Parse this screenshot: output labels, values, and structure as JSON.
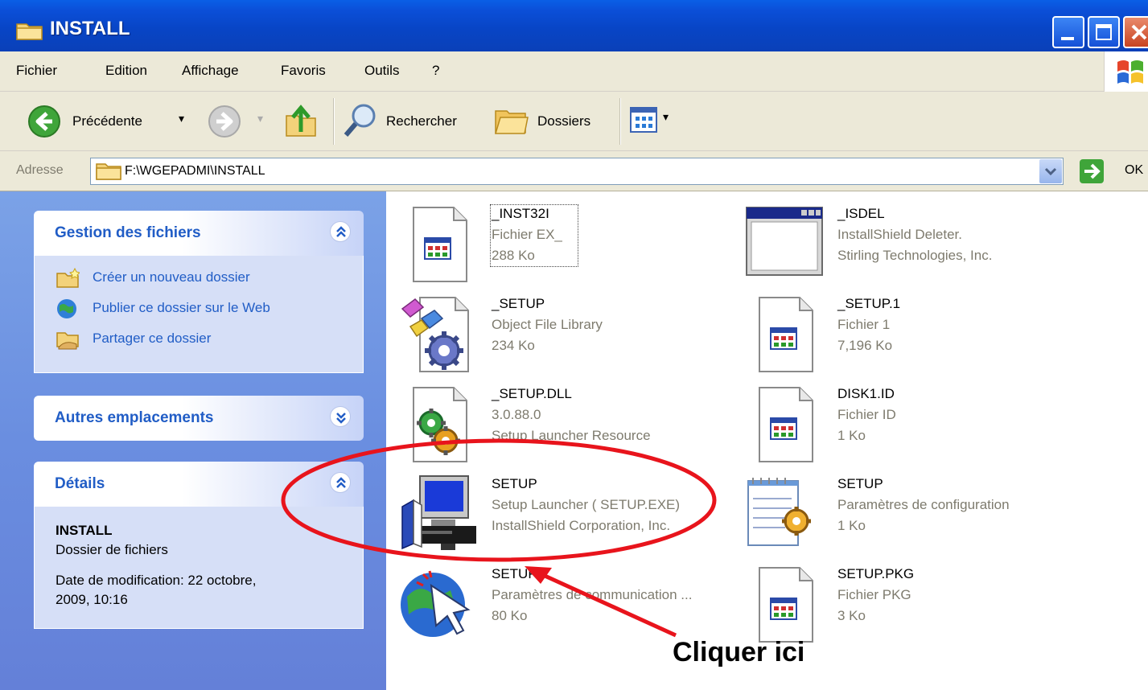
{
  "window": {
    "title": "INSTALL"
  },
  "menubar": {
    "items": [
      "Fichier",
      "Edition",
      "Affichage",
      "Favoris",
      "Outils",
      "?"
    ]
  },
  "toolbar": {
    "back_label": "Précédente",
    "search_label": "Rechercher",
    "folders_label": "Dossiers"
  },
  "address": {
    "label": "Adresse",
    "value": "F:\\WGEPADMI\\INSTALL",
    "go_label": "OK"
  },
  "left_pane": {
    "file_tasks": {
      "title": "Gestion des fichiers",
      "items": [
        {
          "label": "Créer un nouveau dossier",
          "icon": "new-folder-icon"
        },
        {
          "label": "Publier ce dossier sur le Web",
          "icon": "publish-web-icon"
        },
        {
          "label": "Partager ce dossier",
          "icon": "share-folder-icon"
        }
      ]
    },
    "other_places": {
      "title": "Autres emplacements"
    },
    "details": {
      "title": "Détails",
      "name": "INSTALL",
      "type": "Dossier de fichiers",
      "modified_1": "Date de modification: 22 octobre,",
      "modified_2": "2009, 10:16"
    }
  },
  "files": [
    {
      "name": "_INST32I",
      "line2": "Fichier EX_",
      "line3": "288 Ko",
      "icon": "generic-file-icon"
    },
    {
      "name": "_ISDEL",
      "line2": "InstallShield Deleter.",
      "line3": "Stirling Technologies, Inc.",
      "icon": "app-window-icon"
    },
    {
      "name": "_SETUP",
      "line2": "Object File Library",
      "line3": "234 Ko",
      "icon": "library-gear-icon"
    },
    {
      "name": "_SETUP.1",
      "line2": "Fichier 1",
      "line3": "7,196 Ko",
      "icon": "generic-file-icon"
    },
    {
      "name": "_SETUP.DLL",
      "line2": "3.0.88.0",
      "line3": "Setup Launcher Resource",
      "icon": "dll-gear-icon"
    },
    {
      "name": "DISK1.ID",
      "line2": "Fichier ID",
      "line3": "1 Ko",
      "icon": "generic-file-icon"
    },
    {
      "name": "SETUP",
      "line2": "Setup Launcher ( SETUP.EXE)",
      "line3": "InstallShield Corporation, Inc.",
      "icon": "setup-computer-icon"
    },
    {
      "name": "SETUP",
      "line2": "Paramètres de configuration",
      "line3": "1 Ko",
      "icon": "config-notepad-icon"
    },
    {
      "name": "SETUP",
      "line2": "Paramètres de communication ...",
      "line3": "80 Ko",
      "icon": "globe-cursor-icon"
    },
    {
      "name": "SETUP.PKG",
      "line2": "Fichier PKG",
      "line3": "3 Ko",
      "icon": "generic-file-icon"
    }
  ],
  "annotation": {
    "text": "Cliquer ici",
    "color": "#e8141c"
  },
  "colors": {
    "titlebar": "#0845c6",
    "chrome": "#ece9d8",
    "pane_blue": "#6a8ee0",
    "link_blue": "#215dc6"
  }
}
